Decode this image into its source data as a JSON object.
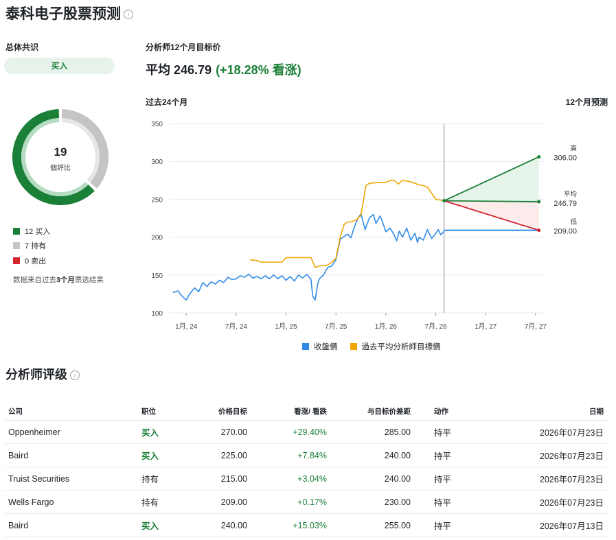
{
  "page": {
    "title": "泰科电子股票预测"
  },
  "consensus": {
    "label": "总体共识",
    "rating": "买入",
    "total": "19",
    "total_label": "個評比",
    "counts": {
      "buy": 12,
      "hold": 7,
      "sell": 0
    },
    "legend": [
      {
        "text": "12 买入",
        "color": "#1a7f37"
      },
      {
        "text": "7 持有",
        "color": "#c4c4c4"
      },
      {
        "text": "0 卖出",
        "color": "#d1242f"
      }
    ],
    "note_prefix": "数据来自过去",
    "note_bold": "3个月",
    "note_suffix": "票选结果"
  },
  "target": {
    "label": "分析师12个月目标价",
    "avg_label": "平均 246.79",
    "pct": "(+18.28% 看涨)"
  },
  "chart_data": {
    "type": "line",
    "past_label": "过去24个月",
    "forecast_label": "12个月预测",
    "y_ticks": [
      "350",
      "300",
      "250",
      "200",
      "150",
      "100"
    ],
    "ylim": [
      100,
      350
    ],
    "x_ticks": [
      "1月, 24",
      "7月, 24",
      "1月, 25",
      "7月, 25",
      "1月, 26",
      "7月, 26",
      "1月, 27",
      "7月, 27"
    ],
    "x_tick_months": [
      0,
      6,
      12,
      18,
      24,
      30,
      36,
      42
    ],
    "forecast_start_month": 31,
    "forecast_end_month": 43,
    "series": [
      {
        "name": "收盤價",
        "color": "#2f8be6",
        "x": [
          -1.6,
          -1,
          -0.5,
          0,
          0.4,
          1,
          1.5,
          2,
          2.5,
          3,
          3.5,
          4,
          4.5,
          5,
          5.5,
          6,
          6.5,
          7,
          7.5,
          8,
          8.5,
          9,
          9.5,
          10,
          10.5,
          11,
          11.5,
          12,
          12.5,
          13,
          13.5,
          14,
          14.5,
          15,
          15.2,
          15.5,
          15.8,
          16,
          16.5,
          17,
          17.5,
          18,
          18.5,
          19,
          19.4,
          19.8,
          20.2,
          20.6,
          21,
          21.5,
          22,
          22.5,
          22.8,
          23,
          23.3,
          23.6,
          24,
          24.5,
          25,
          25.3,
          25.6,
          26,
          26.5,
          27,
          27.5,
          27.8,
          28,
          28.5,
          29,
          29.5,
          30,
          30.3,
          30.6,
          31
        ],
        "values": [
          127,
          129,
          122,
          117,
          125,
          133,
          128,
          140,
          135,
          141,
          138,
          143,
          140,
          147,
          144,
          145,
          149,
          147,
          151,
          146,
          148,
          145,
          149,
          145,
          150,
          145,
          149,
          143,
          148,
          142,
          150,
          146,
          151,
          144,
          122,
          117,
          138,
          145,
          150,
          160,
          162,
          170,
          197,
          201,
          204,
          199,
          213,
          224,
          231,
          210,
          225,
          230,
          218,
          222,
          228,
          220,
          207,
          212,
          203,
          195,
          208,
          200,
          212,
          196,
          205,
          193,
          200,
          196,
          210,
          198,
          205,
          210,
          203,
          208
        ]
      },
      {
        "name": "過去平均分析師目標價",
        "color": "#f0a500",
        "x": [
          7.7,
          8.5,
          9,
          10,
          11,
          11.5,
          12,
          13,
          14,
          15,
          15.5,
          16,
          17,
          17.5,
          18,
          18.5,
          19,
          19.4,
          19.8,
          20.5,
          21,
          21.3,
          21.6,
          22,
          23,
          24,
          24.5,
          25,
          25.5,
          26,
          27,
          28,
          28.5,
          29,
          30,
          31
        ],
        "values": [
          170,
          169,
          167,
          167,
          167,
          167,
          173,
          173,
          173,
          173,
          160,
          162,
          163,
          167,
          172,
          200,
          217,
          220,
          220,
          223,
          229,
          248,
          268,
          271,
          272,
          272,
          275,
          275,
          270,
          275,
          273,
          269,
          268,
          266,
          250,
          248
        ]
      }
    ],
    "forecast": {
      "start": 248,
      "high": {
        "label": "高",
        "value": 306.0,
        "text": "306.00"
      },
      "avg": {
        "label": "平均",
        "value": 246.79,
        "text": "246.79"
      },
      "low": {
        "label": "低",
        "value": 209.0,
        "text": "209.00"
      },
      "current": 209
    },
    "legend": [
      {
        "name": "收盤價",
        "color": "#2f8be6"
      },
      {
        "name": "過去平均分析師目標價",
        "color": "#f0a500"
      }
    ]
  },
  "ratings": {
    "title": "分析师评级",
    "headers": [
      "公司",
      "职位",
      "价格目标",
      "看涨/ 看跌",
      "与目标价差距",
      "动作",
      "日期"
    ],
    "rows": [
      {
        "company": "Oppenheimer",
        "position": "买入",
        "target": "270.00",
        "change": "+29.40%",
        "gap": "285.00",
        "action": "持平",
        "date": "2026年07月23日"
      },
      {
        "company": "Baird",
        "position": "买入",
        "target": "225.00",
        "change": "+7.84%",
        "gap": "240.00",
        "action": "持平",
        "date": "2026年07月23日"
      },
      {
        "company": "Truist Securities",
        "position": "持有",
        "target": "215.00",
        "change": "+3.04%",
        "gap": "240.00",
        "action": "持平",
        "date": "2026年07月23日"
      },
      {
        "company": "Wells Fargo",
        "position": "持有",
        "target": "209.00",
        "change": "+0.17%",
        "gap": "230.00",
        "action": "持平",
        "date": "2026年07月23日"
      },
      {
        "company": "Baird",
        "position": "买入",
        "target": "240.00",
        "change": "+15.03%",
        "gap": "255.00",
        "action": "持平",
        "date": "2026年07月13日"
      }
    ]
  }
}
